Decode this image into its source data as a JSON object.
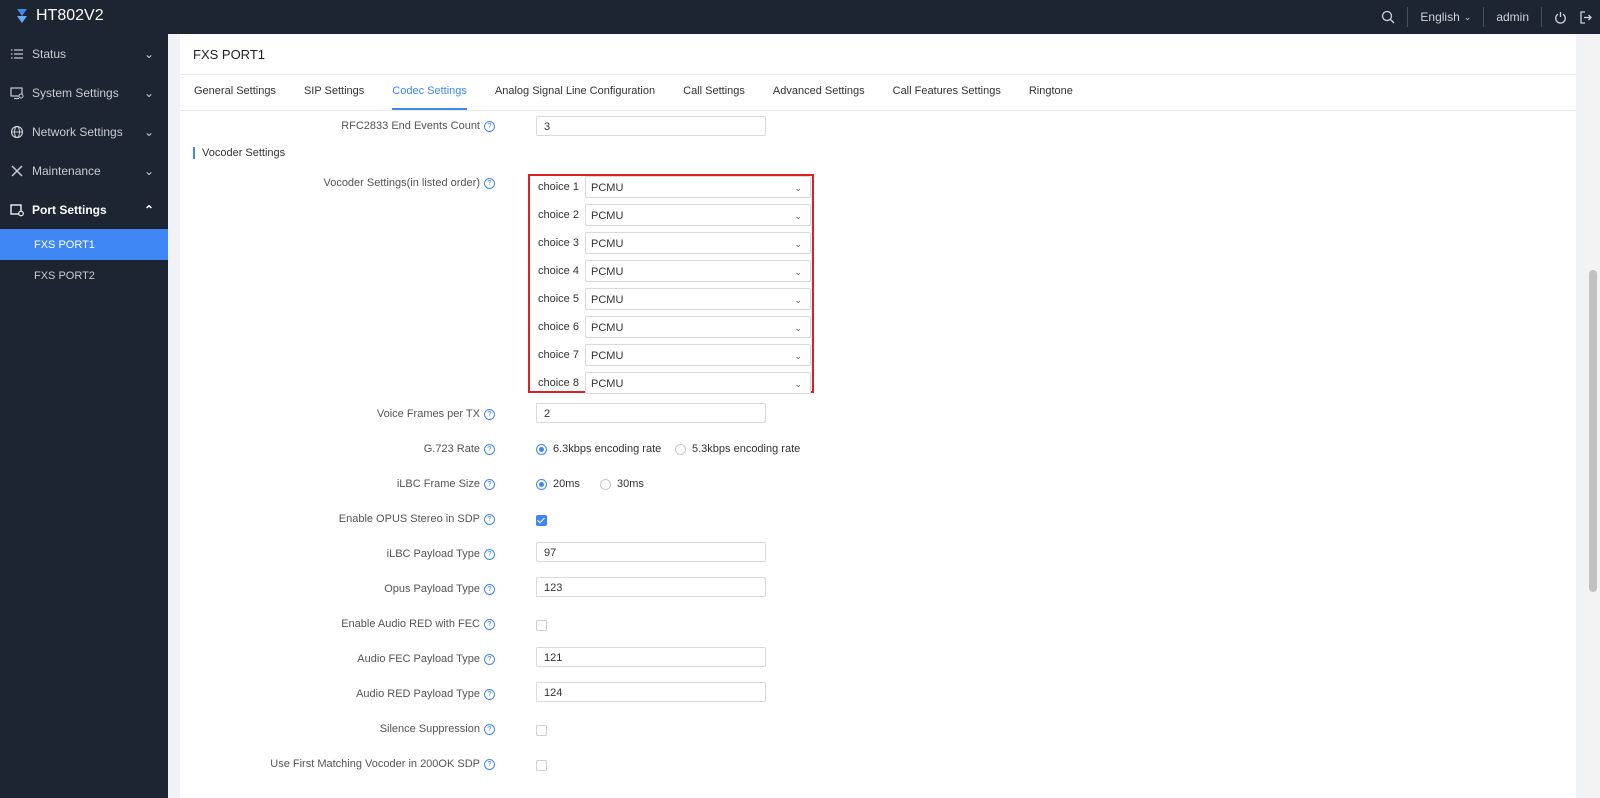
{
  "app": {
    "title": "HT802V2"
  },
  "topbar": {
    "language": "English",
    "user": "admin"
  },
  "sidebar": {
    "items": [
      {
        "label": "Status",
        "icon": "list-icon"
      },
      {
        "label": "System Settings",
        "icon": "monitor-settings-icon"
      },
      {
        "label": "Network Settings",
        "icon": "globe-icon"
      },
      {
        "label": "Maintenance",
        "icon": "tools-icon"
      },
      {
        "label": "Port Settings",
        "icon": "port-icon"
      }
    ],
    "sub_items": [
      "FXS PORT1",
      "FXS PORT2"
    ]
  },
  "page": {
    "title": "FXS PORT1"
  },
  "tabs": [
    "General Settings",
    "SIP Settings",
    "Codec Settings",
    "Analog Signal Line Configuration",
    "Call Settings",
    "Advanced Settings",
    "Call Features Settings",
    "Ringtone"
  ],
  "form": {
    "rfc2833": {
      "label": "RFC2833 End Events Count",
      "value": "3"
    },
    "section_title": "Vocoder Settings",
    "vocoder_label": "Vocoder Settings(in listed order)",
    "choices": [
      {
        "label": "choice 1",
        "value": "PCMU"
      },
      {
        "label": "choice 2",
        "value": "PCMU"
      },
      {
        "label": "choice 3",
        "value": "PCMU"
      },
      {
        "label": "choice 4",
        "value": "PCMU"
      },
      {
        "label": "choice 5",
        "value": "PCMU"
      },
      {
        "label": "choice 6",
        "value": "PCMU"
      },
      {
        "label": "choice 7",
        "value": "PCMU"
      },
      {
        "label": "choice 8",
        "value": "PCMU"
      }
    ],
    "voice_frames": {
      "label": "Voice Frames per TX",
      "value": "2"
    },
    "g723": {
      "label": "G.723 Rate",
      "opt1": "6.3kbps encoding rate",
      "opt2": "5.3kbps encoding rate"
    },
    "ilbc_frame": {
      "label": "iLBC Frame Size",
      "opt1": "20ms",
      "opt2": "30ms"
    },
    "opus_stereo": {
      "label": "Enable OPUS Stereo in SDP"
    },
    "ilbc_payload": {
      "label": "iLBC Payload Type",
      "value": "97"
    },
    "opus_payload": {
      "label": "Opus Payload Type",
      "value": "123"
    },
    "audio_red_fec": {
      "label": "Enable Audio RED with FEC"
    },
    "audio_fec_payload": {
      "label": "Audio FEC Payload Type",
      "value": "121"
    },
    "audio_red_payload": {
      "label": "Audio RED Payload Type",
      "value": "124"
    },
    "silence": {
      "label": "Silence Suppression"
    },
    "first_matching": {
      "label": "Use First Matching Vocoder in 200OK SDP"
    }
  },
  "colors": {
    "accent": "#3f87f5",
    "highlight_box": "#e02020",
    "sidebar_bg": "#1e2532"
  }
}
